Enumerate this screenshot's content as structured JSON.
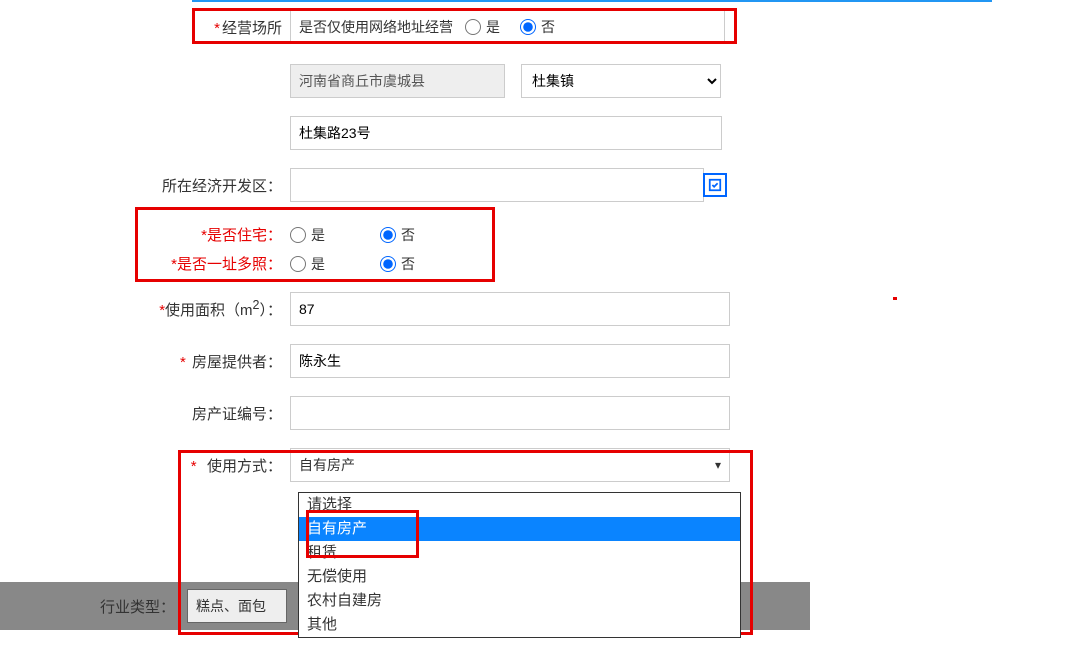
{
  "form": {
    "business_place": {
      "label": "经营场所",
      "question": "是否仅使用网络地址经营",
      "yes": "是",
      "no": "否",
      "selected": "no"
    },
    "region_disabled": "河南省商丘市虞城县",
    "town_select": "杜集镇",
    "address": "杜集路23号",
    "econ_zone_label": "所在经济开发区：",
    "is_residence": {
      "label": "*是否住宅：",
      "yes": "是",
      "no": "否"
    },
    "multi_license": {
      "label": "*是否一址多照：",
      "yes": "是",
      "no": "否"
    },
    "area_label": "*使用面积（m²）：",
    "area_value": "87",
    "provider_label": "房屋提供者：",
    "provider_value": "陈永生",
    "cert_label": "房产证编号：",
    "cert_value": "",
    "usage_mode": {
      "label": "使用方式：",
      "selected": "自有房产",
      "options": [
        "请选择",
        "自有房产",
        "租赁",
        "无偿使用",
        "农村自建房",
        "其他"
      ]
    }
  },
  "bottom": {
    "industry_label": "行业类型：",
    "industry_value": "糕点、面包"
  }
}
